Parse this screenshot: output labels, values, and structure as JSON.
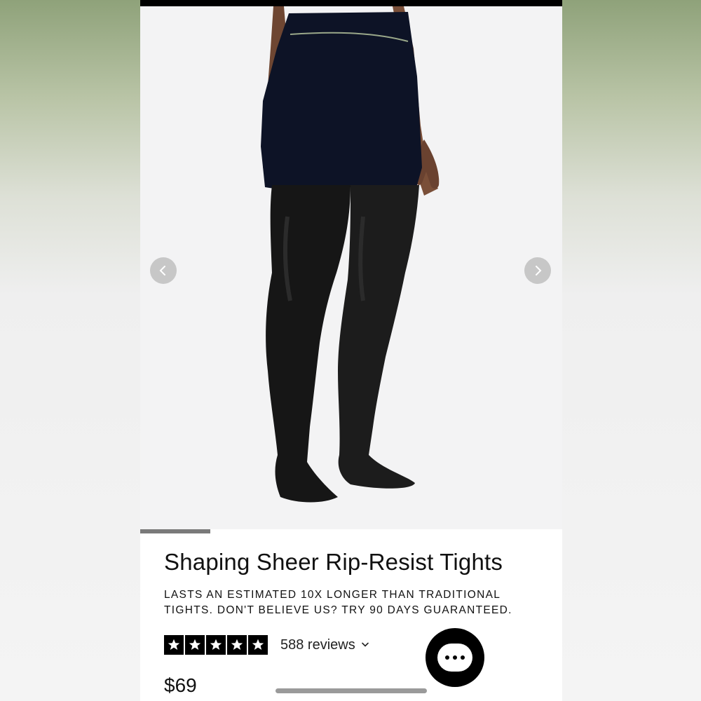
{
  "product": {
    "title": "Shaping Sheer Rip-Resist Tights",
    "tagline": "LASTS AN ESTIMATED 10X LONGER THAN TRADITIONAL TIGHTS. DON'T BELIEVE US? TRY 90 DAYS GUARANTEED.",
    "price": "$69",
    "rating": {
      "stars": 5,
      "max": 5,
      "reviews_label": "588 reviews"
    }
  },
  "gallery": {
    "prev_icon": "chevron-left-icon",
    "next_icon": "chevron-right-icon",
    "progress": 0.166
  },
  "chat": {
    "icon": "chat-bubble-icon"
  },
  "colors": {
    "accent": "#000000",
    "background": "#ffffff",
    "gallery_bg": "#f3f3f4",
    "progress_fill": "#7a7a7a",
    "nav_arrow_bg": "#bebebe"
  }
}
